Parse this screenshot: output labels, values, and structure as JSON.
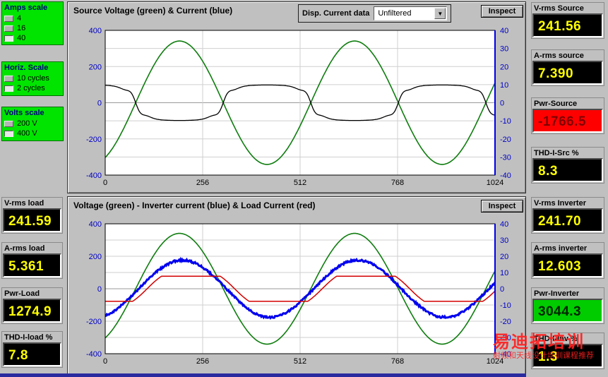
{
  "header": {
    "disp_label": "Disp. Current data",
    "disp_value": "Unfiltered",
    "inspect_label": "Inspect"
  },
  "scales": {
    "amps": {
      "title": "Amps scale",
      "options": [
        {
          "label": "4",
          "selected": false
        },
        {
          "label": "16",
          "selected": false
        },
        {
          "label": "40",
          "selected": true
        }
      ]
    },
    "horiz": {
      "title": "Horiz. Scale",
      "options": [
        {
          "label": "10 cycles",
          "selected": false
        },
        {
          "label": "2 cycles",
          "selected": true
        }
      ]
    },
    "volts": {
      "title": "Volts scale",
      "options": [
        {
          "label": "200 V",
          "selected": false
        },
        {
          "label": "400 V",
          "selected": true
        }
      ]
    }
  },
  "indicators": {
    "left": [
      {
        "label": "V-rms load",
        "value": "241.59"
      },
      {
        "label": "A-rms load",
        "value": "5.361"
      },
      {
        "label": "Pwr-Load",
        "value": "1274.9"
      },
      {
        "label": "THD-I-load  %",
        "value": "7.8"
      }
    ],
    "right_top": [
      {
        "label": "V-rms Source",
        "value": "241.56"
      },
      {
        "label": "A-rms source",
        "value": "7.390"
      },
      {
        "label": "Pwr-Source",
        "value": "-1766.5"
      },
      {
        "label": "THD-I-Src  %",
        "value": "8.3"
      }
    ],
    "right_bottom": [
      {
        "label": "V-rms Inverter",
        "value": "241.70"
      },
      {
        "label": "A-rms inverter",
        "value": "12.603"
      },
      {
        "label": "Pwr-Inverter",
        "value": "3044.3"
      },
      {
        "label": "THD-I-Inv  %",
        "value": "1.3"
      }
    ]
  },
  "watermark": {
    "line1": "易迪拓培训",
    "line2": "射频和天线设计培训课程推荐"
  },
  "chart_data": [
    {
      "id": "top",
      "type": "line",
      "title": "Source Voltage (green) & Current (blue)",
      "x_range": [
        0,
        1024
      ],
      "x_ticks": [
        0,
        256,
        512,
        768,
        1024
      ],
      "y_left": {
        "range": [
          -400,
          400
        ],
        "ticks": [
          400,
          200,
          0,
          -200,
          -400
        ]
      },
      "y_right": {
        "range": [
          -40,
          40
        ],
        "ticks": [
          40,
          30,
          20,
          10,
          0,
          -10,
          -20,
          -30,
          -40
        ]
      },
      "grid": true,
      "series": [
        {
          "name": "source-voltage",
          "color": "#0f7d0f",
          "width": 1.6,
          "axis": "left",
          "shape": "sine",
          "amp": 341,
          "period": 460,
          "zero_cross": 80
        },
        {
          "name": "source-current",
          "color": "#000000",
          "width": 1.3,
          "axis": "right",
          "shape": "flattop",
          "amp": 9.8,
          "period": 460,
          "zero_cross": 80,
          "invert": true,
          "notch": true
        }
      ]
    },
    {
      "id": "bottom",
      "type": "line",
      "title": "Voltage (green) - Inverter current (blue) & Load Current (red)",
      "x_range": [
        0,
        1024
      ],
      "x_ticks": [
        0,
        256,
        512,
        768,
        1024
      ],
      "y_left": {
        "range": [
          -400,
          400
        ],
        "ticks": [
          400,
          200,
          0,
          -200,
          -400
        ]
      },
      "y_right": {
        "range": [
          -40,
          40
        ],
        "ticks": [
          40,
          30,
          20,
          10,
          0,
          -10,
          -20,
          -30,
          -40
        ]
      },
      "grid": true,
      "series": [
        {
          "name": "voltage",
          "color": "#0f7d0f",
          "width": 1.6,
          "axis": "left",
          "shape": "sine",
          "amp": 341,
          "period": 460,
          "zero_cross": 80
        },
        {
          "name": "inverter-current",
          "color": "#0000ee",
          "width": 3,
          "axis": "right",
          "shape": "sine",
          "amp": 17.6,
          "period": 460,
          "zero_cross": 88,
          "noise": 0.6
        },
        {
          "name": "load-current",
          "color": "#d40000",
          "width": 1.5,
          "axis": "right",
          "shape": "clipped",
          "amp": 13,
          "clip": 7.7,
          "period": 460,
          "zero_cross": 110
        }
      ]
    }
  ]
}
